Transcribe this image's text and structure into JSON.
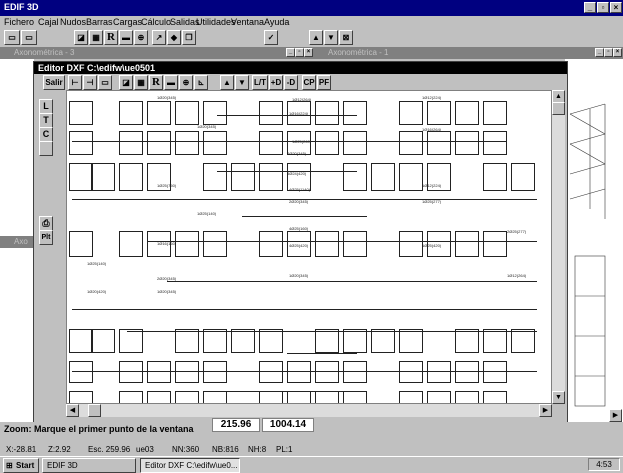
{
  "app": {
    "title": "EDIF 3D"
  },
  "menu": [
    "Fichero",
    "Cajal",
    "Nudos",
    "Barras",
    "Cargas",
    "Cálculo",
    "Salidas",
    "Utilidades",
    "Ventana",
    "Ayuda"
  ],
  "subwindows": {
    "left_title": "Axonométrica - 3",
    "right_title": "Axonométrica - 1",
    "lower_left_title": "Axo"
  },
  "dxf_editor": {
    "title": "Editor DXF C:\\edifw\\ue0501",
    "salir": "Salir",
    "tools": [
      "R",
      "L/T",
      "+D",
      "-D",
      "CP",
      "PF"
    ],
    "side": [
      "L",
      "T",
      "C",
      "Plt"
    ],
    "coord_x": "215.96",
    "coord_y": "1004.14",
    "labels": [
      "1Ø20(345)",
      "1Ø12(264)",
      "1Ø12(224)",
      "1Ø16(224)",
      "1Ø20(345)",
      "1Ø25(260)",
      "1Ø16(264)",
      "2Ø20(345)",
      "1Ø25(750)",
      "5Ø24(420)",
      "1Ø12(224)",
      "4Ø25(1140)",
      "1Ø25(140)",
      "2Ø20(345)",
      "1Ø25(277)",
      "4Ø25(160)",
      "2Ø25(277)",
      "1Ø16(160)",
      "4Ø25(420)",
      "1Ø25(420)",
      "1Ø25(140)",
      "2Ø20(345)",
      "1Ø20(345)",
      "1Ø12(264)",
      "1Ø20(420)",
      "1Ø20(345)",
      "1Ø20(400)",
      "1Ø20(345)"
    ]
  },
  "zoom_prompt": "Zoom: Marque el primer punto de la ventana",
  "status": {
    "x": "X:-28.81",
    "z": "Z:2.92",
    "esc": "Esc. 259.96",
    "file": "ue03",
    "nn": "NN:360",
    "nb": "NB:816",
    "nh": "NH:8",
    "pl": "PL:1"
  },
  "taskbar": {
    "start": "Start",
    "task1": "EDIF 3D",
    "task2": "Editor DXF C:\\edifw\\ue0...",
    "clock": "4:53"
  }
}
